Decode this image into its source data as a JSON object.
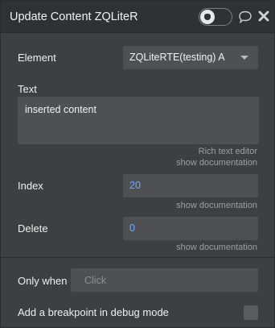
{
  "window": {
    "title": "Update Content ZQLiteR"
  },
  "header": {
    "debug_toggle_icon": "bug-icon",
    "comment_icon": "comment-icon",
    "close_icon": "close-icon"
  },
  "form": {
    "element_label": "Element",
    "element_value": "ZQLiteRTE(testing) A",
    "text_label": "Text",
    "text_value": "inserted content",
    "text_hint_1": "Rich text editor",
    "text_hint_2": "show documentation",
    "index_label": "Index",
    "index_value": "20",
    "index_hint": "show documentation",
    "delete_label": "Delete",
    "delete_value": "0",
    "delete_hint": "show documentation",
    "only_when_label": "Only when",
    "only_when_placeholder": "Click",
    "breakpoint_label": "Add a breakpoint in debug mode"
  },
  "colors": {
    "panel_bg": "#3d3f42",
    "field_bg": "#4e5054",
    "value_blue": "#6ea8ff",
    "hint_gray": "#9d9fa3"
  }
}
